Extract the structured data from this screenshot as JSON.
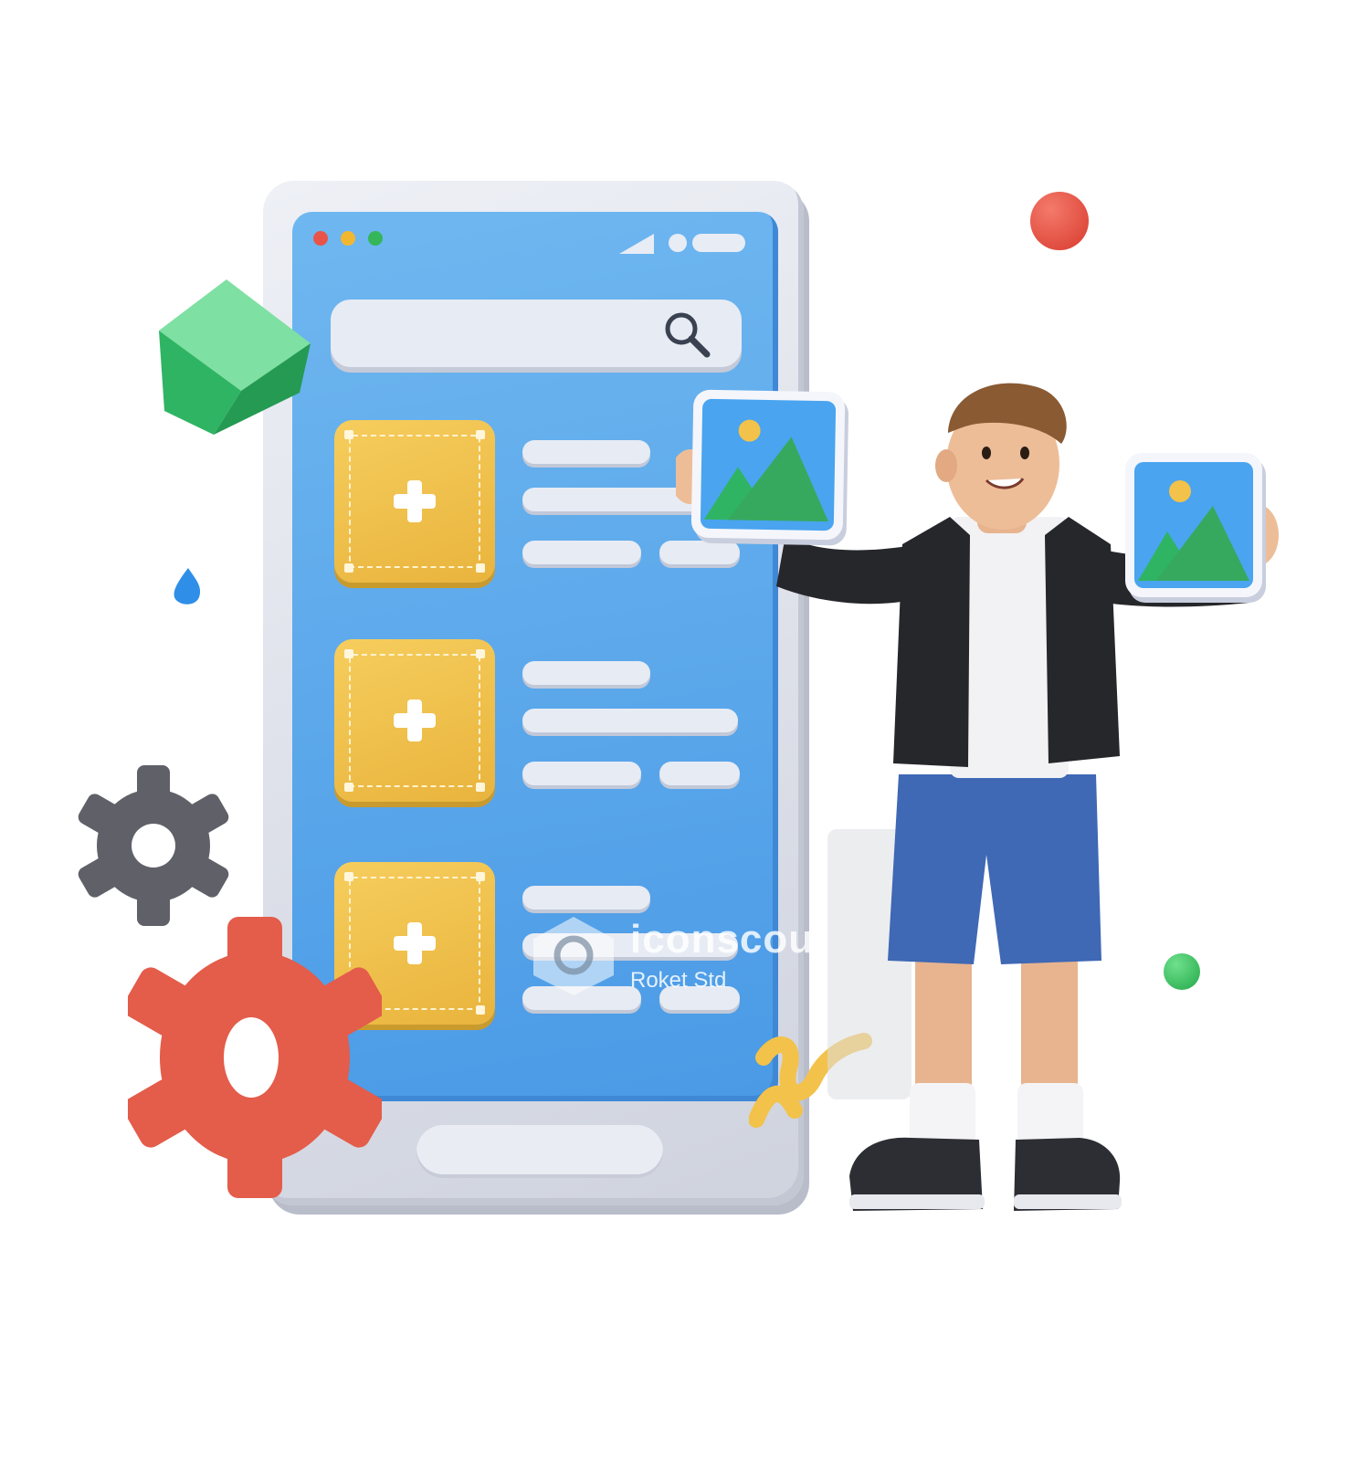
{
  "watermark": {
    "brand": "iconscout",
    "author": "Roket Std"
  },
  "colors": {
    "screen": "#5aa8ec",
    "card": "#f2c24f",
    "gear_gray": "#5f6068",
    "gear_red": "#e45c4a",
    "cube": "#3ec57a",
    "ball_red": "#e04a3c",
    "ball_green": "#2fbf5a",
    "jacket": "#26272b",
    "shorts": "#3f68b5"
  },
  "icons": {
    "search": "search-icon",
    "image": "image-icon",
    "plus": "plus-icon",
    "gear": "gear-icon"
  }
}
